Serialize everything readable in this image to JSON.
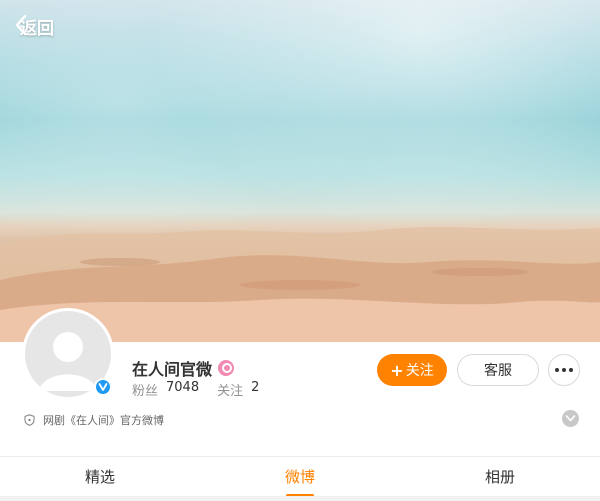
{
  "header": {
    "back_label": "返回"
  },
  "profile": {
    "name": "在人间官微",
    "verified": true,
    "stats": {
      "followers_label": "粉丝",
      "followers_value": "7048",
      "following_label": "关注",
      "following_value": "2"
    },
    "description": "网剧《在人间》官方微博"
  },
  "actions": {
    "follow_label": "关注",
    "service_label": "客服"
  },
  "tabs": [
    {
      "label": "精选",
      "active": false
    },
    {
      "label": "微博",
      "active": true
    },
    {
      "label": "相册",
      "active": false
    }
  ],
  "colors": {
    "accent": "#ff8200",
    "verified": "#1e9af5",
    "badge": "#f28bb4"
  }
}
